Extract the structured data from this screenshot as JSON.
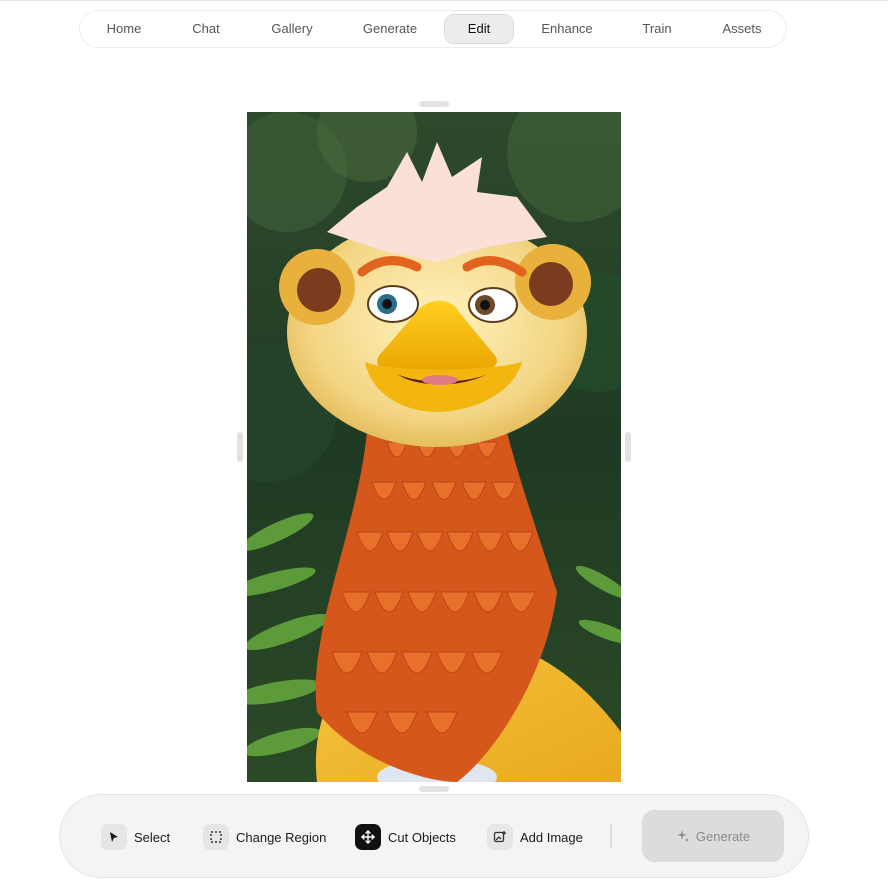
{
  "nav": {
    "items": [
      {
        "label": "Home"
      },
      {
        "label": "Chat"
      },
      {
        "label": "Gallery"
      },
      {
        "label": "Generate"
      },
      {
        "label": "Edit",
        "active": true
      },
      {
        "label": "Enhance"
      },
      {
        "label": "Train"
      },
      {
        "label": "Assets"
      }
    ]
  },
  "canvas": {
    "image": "cartoon-yellow-duck-faced-creature-with-orange-feather-ruff"
  },
  "toolbar": {
    "select_label": "Select",
    "change_region_label": "Change Region",
    "cut_objects_label": "Cut Objects",
    "add_image_label": "Add Image",
    "generate_label": "Generate",
    "icons": {
      "select": "cursor-arrow-icon",
      "change_region": "dashed-region-icon",
      "cut_objects": "move-arrows-icon",
      "add_image": "add-image-icon",
      "generate": "sparkle-icon"
    }
  },
  "colors": {
    "accent_dark": "#111111",
    "generate_disabled_bg": "#dcdcdc",
    "toolbar_bg": "#f4f4f4"
  }
}
